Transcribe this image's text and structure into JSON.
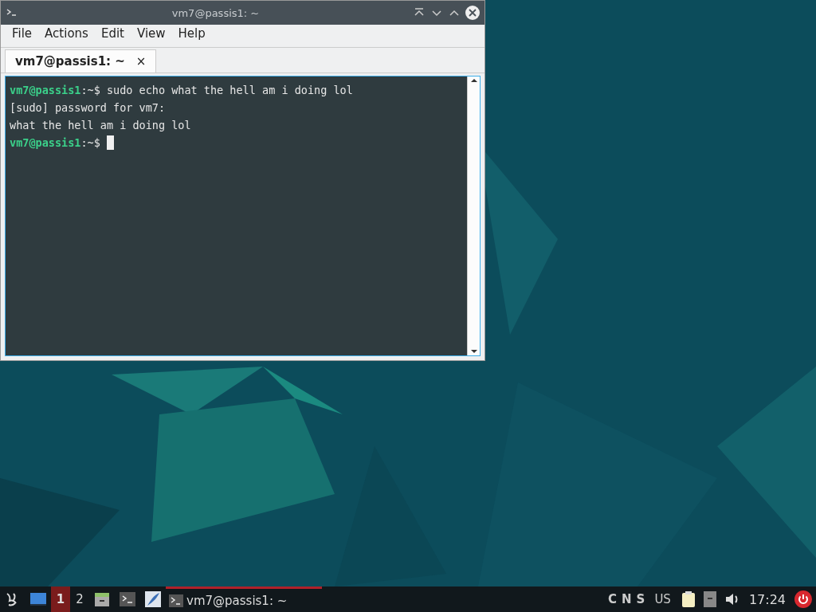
{
  "window": {
    "title": "vm7@passis1: ~",
    "menu": [
      "File",
      "Actions",
      "Edit",
      "View",
      "Help"
    ],
    "tabs": [
      {
        "label": "vm7@passis1: ~",
        "selected": true,
        "close": "×"
      }
    ],
    "terminal": {
      "lines": [
        {
          "kind": "prompt",
          "user": "vm7@passis1",
          "path": ":~$",
          "command": "sudo echo what the hell am i doing lol",
          "cursor": false
        },
        {
          "kind": "output",
          "text": "[sudo] password for vm7:"
        },
        {
          "kind": "output",
          "text": "what the hell am i doing lol"
        },
        {
          "kind": "prompt",
          "user": "vm7@passis1",
          "path": ":~$",
          "cursor": true
        }
      ]
    }
  },
  "taskbar": {
    "workspaces": [
      {
        "label": "1",
        "selected": true
      },
      {
        "label": "2",
        "selected": false
      }
    ],
    "tasks": [
      {
        "label": "vm7@passis1: ~",
        "selected": true
      }
    ],
    "indicators": [
      "C",
      "N",
      "S"
    ],
    "keyboard": "US",
    "clock": "17:24"
  }
}
